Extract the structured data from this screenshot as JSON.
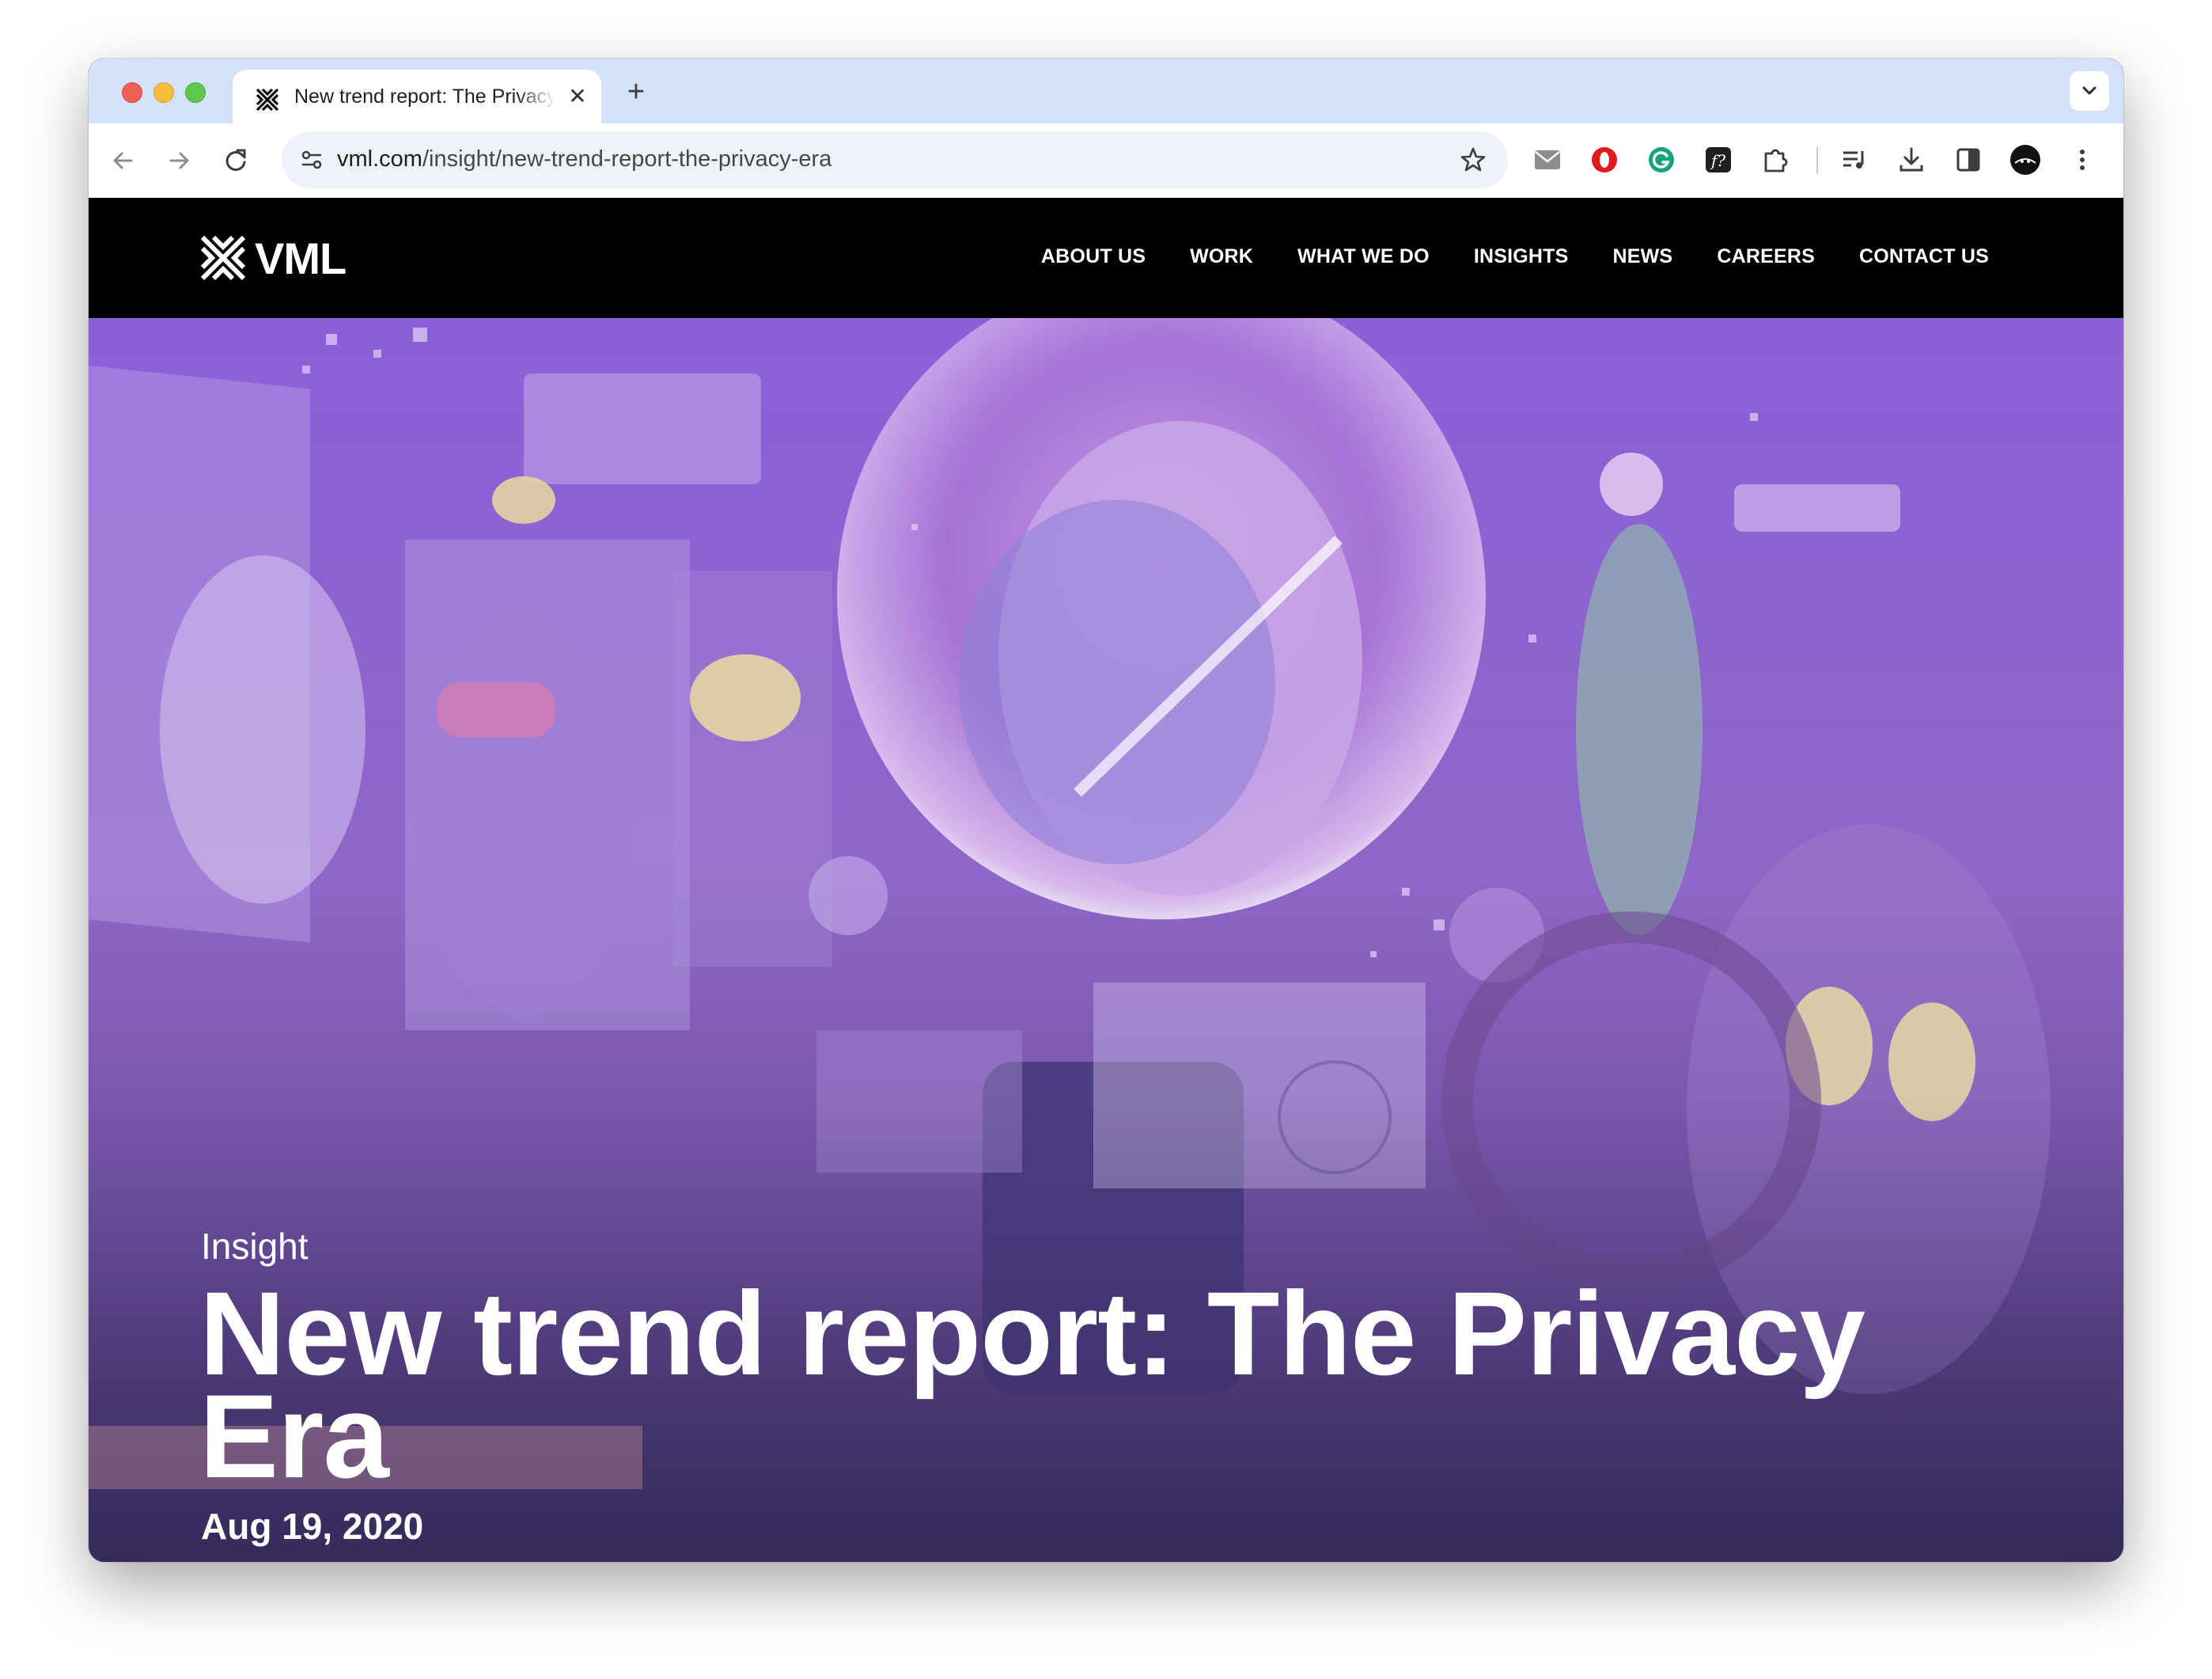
{
  "browser": {
    "tab": {
      "title": "New trend report: The Privacy Era",
      "close_glyph": "✕"
    },
    "new_tab_glyph": "+",
    "address": {
      "domain": "vml.com",
      "path": "/insight/new-trend-report-the-privacy-era"
    },
    "extensions": [
      "mail-icon",
      "opera-icon",
      "grammarly-icon",
      "font-icon",
      "puzzle-icon",
      "media-icon",
      "download-icon",
      "sidepanel-icon",
      "profile-avatar",
      "menu-icon"
    ]
  },
  "site": {
    "logo_text": "VML",
    "nav": [
      "ABOUT US",
      "WORK",
      "WHAT WE DO",
      "INSIGHTS",
      "NEWS",
      "CAREERS",
      "CONTACT US"
    ]
  },
  "hero": {
    "label": "Insight",
    "title": "New trend report: The Privacy Era",
    "date": "Aug 19, 2020"
  },
  "colors": {
    "tabstrip": "#d3e1f9",
    "hero_purple": "#8a5cd6",
    "hero_dark": "#4a3a78"
  }
}
